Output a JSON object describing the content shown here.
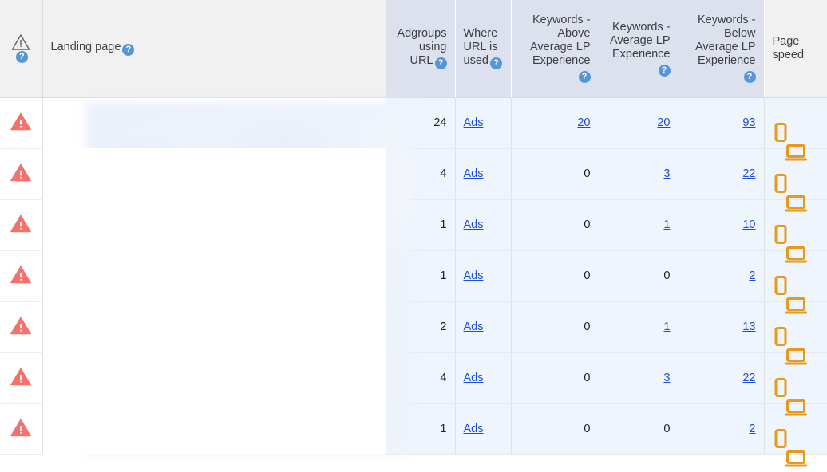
{
  "colors": {
    "header_metric_bg": "#dde1ed",
    "header_plain_bg": "#f1f1f1",
    "cell_bg": "#eff5fc",
    "link": "#1a4ed8",
    "warning": "#f4726b",
    "device_icon": "#e8991a",
    "help_icon": "#5596d8"
  },
  "table": {
    "headers": {
      "alert": "",
      "landing_page": "Landing page",
      "adgroups_using_url": "Adgroups using URL",
      "where_url_is_used": "Where URL is used",
      "keywords_above_average": "Keywords - Above Average LP Experience",
      "keywords_average": "Keywords - Average LP Experience",
      "keywords_below_average": "Keywords - Below Average LP Experience",
      "page_speed": "Page speed"
    },
    "help_glyph": "?",
    "rows": [
      {
        "adgroups": "24",
        "where": "Ads",
        "above": "20",
        "above_link": true,
        "average": "20",
        "average_link": true,
        "below": "93",
        "below_link": true
      },
      {
        "adgroups": "4",
        "where": "Ads",
        "above": "0",
        "above_link": false,
        "average": "3",
        "average_link": true,
        "below": "22",
        "below_link": true
      },
      {
        "adgroups": "1",
        "where": "Ads",
        "above": "0",
        "above_link": false,
        "average": "1",
        "average_link": true,
        "below": "10",
        "below_link": true
      },
      {
        "adgroups": "1",
        "where": "Ads",
        "above": "0",
        "above_link": false,
        "average": "0",
        "average_link": false,
        "below": "2",
        "below_link": true
      },
      {
        "adgroups": "2",
        "where": "Ads",
        "above": "0",
        "above_link": false,
        "average": "1",
        "average_link": true,
        "below": "13",
        "below_link": true
      },
      {
        "adgroups": "4",
        "where": "Ads",
        "above": "0",
        "above_link": false,
        "average": "3",
        "average_link": true,
        "below": "22",
        "below_link": true
      },
      {
        "adgroups": "1",
        "where": "Ads",
        "above": "0",
        "above_link": false,
        "average": "0",
        "average_link": false,
        "below": "2",
        "below_link": true
      }
    ]
  }
}
